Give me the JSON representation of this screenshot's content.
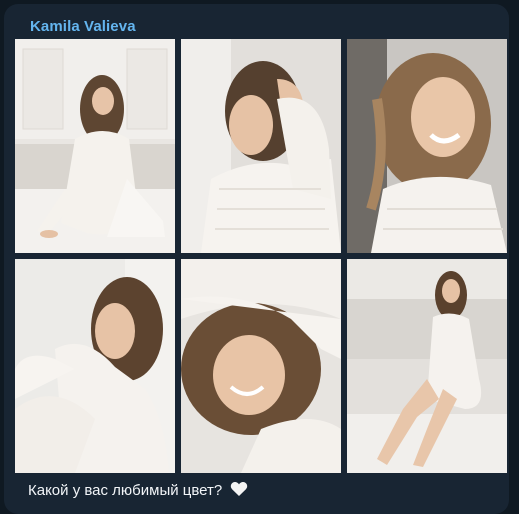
{
  "message": {
    "sender": "Kamila Valieva",
    "caption": "Какой у вас любимый цвет?",
    "emoji": "white-heart-icon"
  },
  "photos": [
    {
      "name": "photo-1"
    },
    {
      "name": "photo-2"
    },
    {
      "name": "photo-3"
    },
    {
      "name": "photo-4"
    },
    {
      "name": "photo-5"
    },
    {
      "name": "photo-6"
    }
  ],
  "colors": {
    "background": "#0f1922",
    "bubble": "#182533",
    "sender": "#64b5ef",
    "text": "#f2f5f8"
  }
}
